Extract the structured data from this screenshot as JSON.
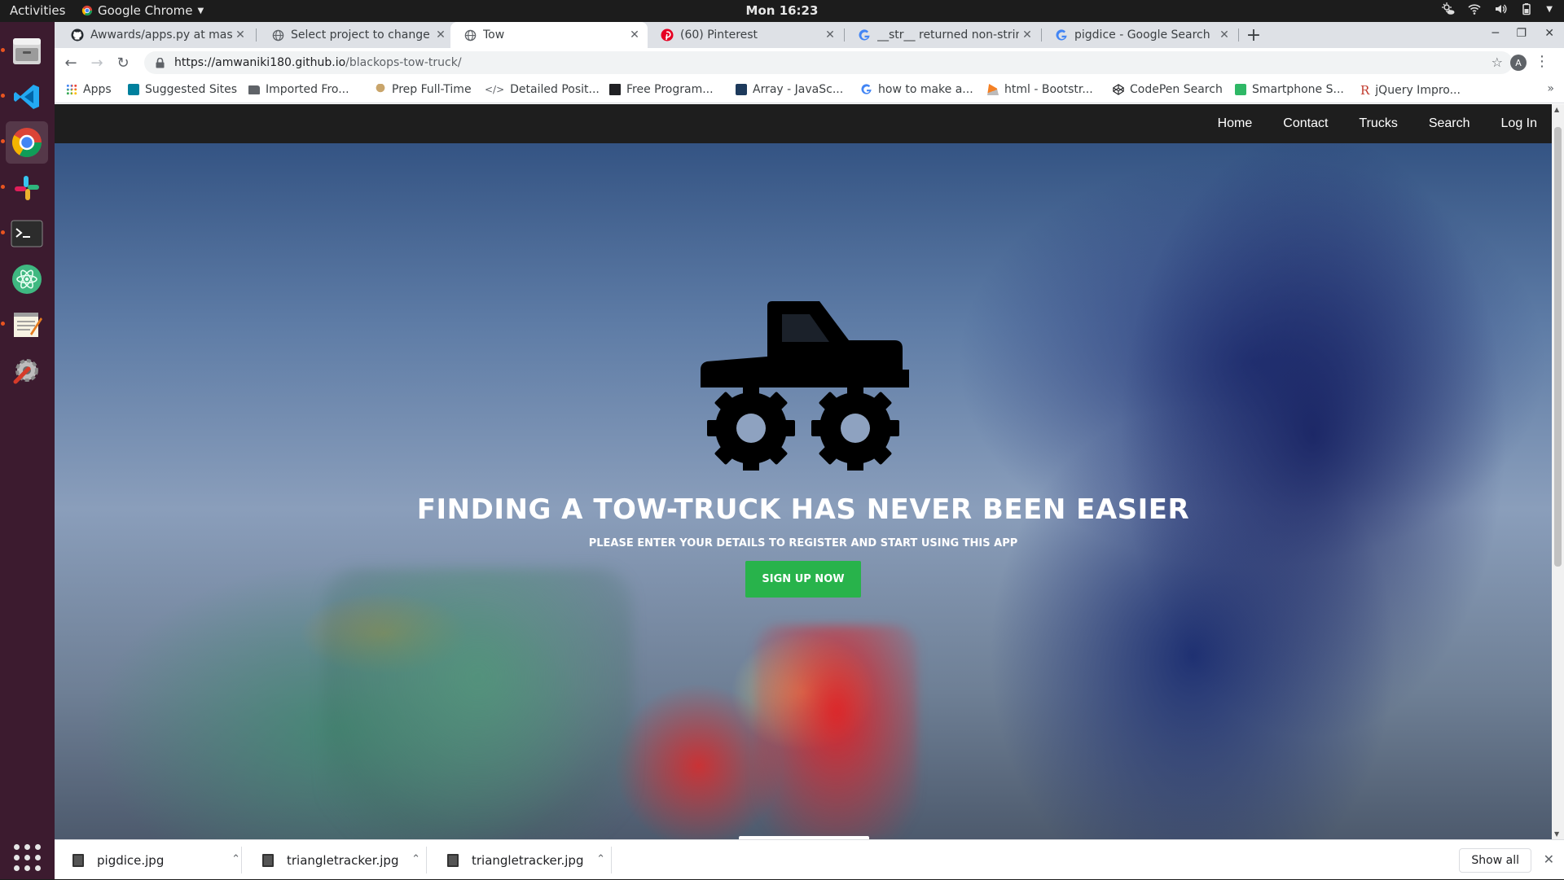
{
  "topbar": {
    "activities": "Activities",
    "app_name": "Google Chrome",
    "clock": "Mon 16:23"
  },
  "dock": {
    "items": [
      "files",
      "vscode",
      "chrome",
      "slack",
      "terminal",
      "atom",
      "text-editor",
      "settings"
    ]
  },
  "tabs": [
    {
      "title": "Awwards/apps.py at mast",
      "icon": "github-icon"
    },
    {
      "title": "Select project to change |",
      "icon": "globe-icon"
    },
    {
      "title": "Tow",
      "icon": "globe-icon",
      "active": true
    },
    {
      "title": "(60) Pinterest",
      "icon": "pinterest-icon"
    },
    {
      "title": "__str__ returned non-strin",
      "icon": "google-icon"
    },
    {
      "title": "pigdice - Google Search",
      "icon": "google-icon"
    }
  ],
  "address": {
    "host": "https://amwaniki180.github.io",
    "path": "/blackops-tow-truck/",
    "avatar": "A"
  },
  "bookmarks": [
    {
      "label": "Apps",
      "icon": "apps-grid-icon"
    },
    {
      "label": "Suggested Sites",
      "icon": "bing-icon"
    },
    {
      "label": "Imported Fro...",
      "icon": "folder-icon"
    },
    {
      "label": "Prep Full-Time",
      "icon": "tree-icon"
    },
    {
      "label": "Detailed Posit...",
      "icon": "code-icon"
    },
    {
      "label": "Free Program...",
      "icon": "book-icon"
    },
    {
      "label": "Array - JavaSc...",
      "icon": "mdn-icon"
    },
    {
      "label": "how to make a...",
      "icon": "google-icon"
    },
    {
      "label": "html - Bootstr...",
      "icon": "stackoverflow-icon"
    },
    {
      "label": "CodePen Search",
      "icon": "codepen-icon"
    },
    {
      "label": "Smartphone S...",
      "icon": "px-icon"
    },
    {
      "label": "jQuery Impro...",
      "icon": "r-icon"
    }
  ],
  "site": {
    "nav": [
      "Home",
      "Contact",
      "Trucks",
      "Search",
      "Log In"
    ],
    "headline": "FINDING A TOW-TRUCK HAS NEVER BEEN EASIER",
    "subheadline": "PLEASE ENTER YOUR DETAILS TO REGISTER AND START USING THIS APP",
    "cta": "SIGN UP NOW"
  },
  "downloads": {
    "files": [
      "pigdice.jpg",
      "triangletracker.jpg",
      "triangletracker.jpg"
    ],
    "show_all": "Show all"
  },
  "colors": {
    "cta_green": "#28b34b",
    "nav_bg": "#1e1e1e",
    "dock_bg": "#3c1b2f",
    "accent_orange": "#e95420"
  }
}
